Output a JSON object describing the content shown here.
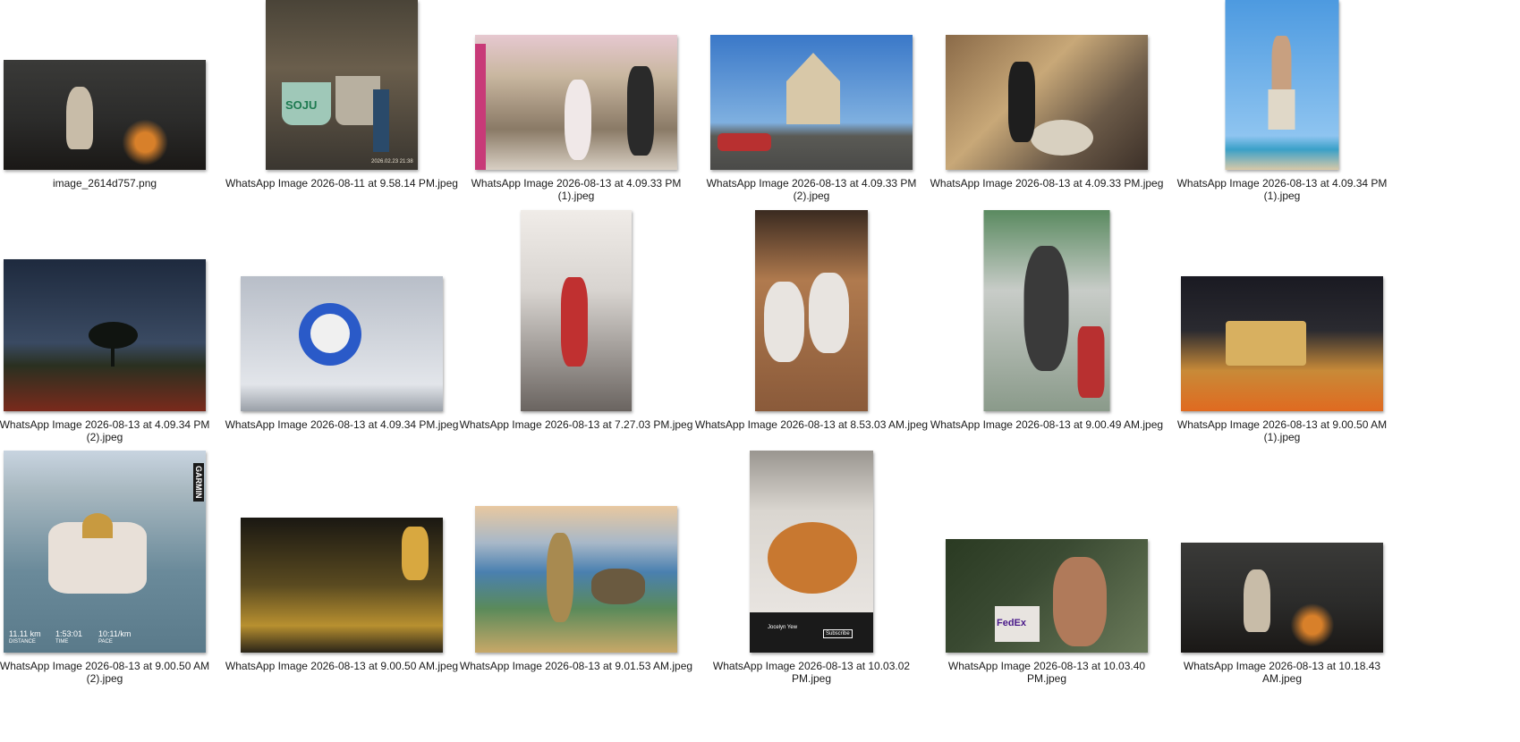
{
  "files": [
    {
      "name": "image_2614d757.png",
      "thumb": "woman-fire-icon",
      "colors": [
        "#2b2b2a",
        "#5e5850",
        "#1a1816"
      ]
    },
    {
      "name": "WhatsApp Image 2026-08-11 at 9.58.14 PM.jpeg",
      "thumb": "soju-table-icon",
      "colors": [
        "#3a3630",
        "#9a8a6e",
        "#2a2622"
      ],
      "overlay": {
        "logo": "SOJU",
        "stamp": "2026.02.23 21:38"
      }
    },
    {
      "name": "WhatsApp Image 2026-08-13 at 4.09.33 PM (1).jpeg",
      "thumb": "street-market-icon",
      "colors": [
        "#c9b7a0",
        "#8a7a66",
        "#d8cfc3"
      ]
    },
    {
      "name": "WhatsApp Image 2026-08-13 at 4.09.33 PM (2).jpeg",
      "thumb": "building-sky-icon",
      "colors": [
        "#4f86c6",
        "#7fb0e0",
        "#5a5a55"
      ]
    },
    {
      "name": "WhatsApp Image 2026-08-13 at 4.09.33 PM.jpeg",
      "thumb": "market-food-icon",
      "colors": [
        "#6b5a48",
        "#c8a878",
        "#3c3028"
      ]
    },
    {
      "name": "WhatsApp Image 2026-08-13 at 4.09.34 PM (1).jpeg",
      "thumb": "beach-acrobat-icon",
      "colors": [
        "#4d9ae0",
        "#8ec4f0",
        "#d9c9a8"
      ]
    },
    {
      "name": "WhatsApp Image 2026-08-13 at 4.09.34 PM (2).jpeg",
      "thumb": "star-trails-icon",
      "colors": [
        "#1e2a3e",
        "#3a4a62",
        "#7a2a1c"
      ]
    },
    {
      "name": "WhatsApp Image 2026-08-13 at 4.09.34 PM.jpeg",
      "thumb": "balloon-sky-icon",
      "colors": [
        "#c5cad2",
        "#e2e5ea",
        "#9aa0a8"
      ]
    },
    {
      "name": "WhatsApp Image 2026-08-13 at 7.27.03 PM.jpeg",
      "thumb": "stage-performer-icon",
      "colors": [
        "#d8d4d0",
        "#b03030",
        "#6a6460"
      ]
    },
    {
      "name": "WhatsApp Image 2026-08-13 at 8.53.03 AM.jpeg",
      "thumb": "two-women-icon",
      "colors": [
        "#b07a4e",
        "#e8e4e0",
        "#8a5a3a"
      ]
    },
    {
      "name": "WhatsApp Image 2026-08-13 at 9.00.49 AM.jpeg",
      "thumb": "fuel-pump-icon",
      "colors": [
        "#8a9a8a",
        "#c8ccc8",
        "#b83030"
      ]
    },
    {
      "name": "WhatsApp Image 2026-08-13 at 9.00.50 AM (1).jpeg",
      "thumb": "night-festival-icon",
      "colors": [
        "#1a1a22",
        "#c88a38",
        "#e06a20"
      ]
    },
    {
      "name": "WhatsApp Image 2026-08-13 at 9.00.50 AM (2).jpeg",
      "thumb": "mosque-aerial-icon",
      "colors": [
        "#6a8a9a",
        "#a8b8c0",
        "#d8d0c8"
      ],
      "overlay": {
        "brand": "GARMIN",
        "distance": "11.11 km",
        "distance_label": "DISTANCE",
        "time": "1:53:01",
        "time_label": "TIME",
        "pace": "10:11/km",
        "pace_label": "PACE"
      }
    },
    {
      "name": "WhatsApp Image 2026-08-13 at 9.00.50 AM.jpeg",
      "thumb": "parade-night-icon",
      "colors": [
        "#2a2418",
        "#b89030",
        "#5a4a20"
      ]
    },
    {
      "name": "WhatsApp Image 2026-08-13 at 9.01.53 AM.jpeg",
      "thumb": "dinosaurs-icon",
      "colors": [
        "#5a8a5a",
        "#c8a868",
        "#4a80b0"
      ]
    },
    {
      "name": "WhatsApp Image 2026-08-13 at 10.03.02 PM.jpeg",
      "thumb": "noodles-video-icon",
      "colors": [
        "#dad6d0",
        "#c87830",
        "#1a1a1a"
      ],
      "overlay": {
        "user": "Jocelyn Yew",
        "subscribe": "Subscribe"
      }
    },
    {
      "name": "WhatsApp Image 2026-08-13 at 10.03.40 PM.jpeg",
      "thumb": "forest-man-icon",
      "colors": [
        "#3a4a32",
        "#6a7a5a",
        "#b07a5a"
      ],
      "overlay": {
        "logo": "FedEx"
      }
    },
    {
      "name": "WhatsApp Image 2026-08-13 at 10.18.43 AM.jpeg",
      "thumb": "woman-fire-icon",
      "colors": [
        "#2b2b2a",
        "#5e5850",
        "#1a1816"
      ]
    }
  ]
}
